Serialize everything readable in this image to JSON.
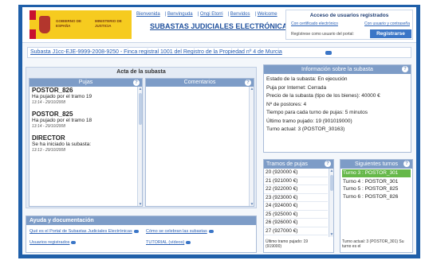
{
  "header": {
    "logo_left_text": "GOBIERNO DE ESPAÑA",
    "logo_right_text": "MINISTERIO DE JUSTICIA",
    "nav": [
      "Bienvenida",
      "Benvinguda",
      "Ongi Etorri",
      "Benvidos",
      "Welcome"
    ],
    "site_title": "SUBASTAS JUDICIALES ELECTRÓNICAS"
  },
  "registered": {
    "title": "Acceso de usuarios registrados",
    "link_certificate": "Con certificado electrónico",
    "link_password": "Con usuario y contraseña",
    "register_text": "Regístrese como usuario del portal:",
    "register_button": "Registrarse"
  },
  "breadcrumb": "Subasta J1cc-EJE-9999-2008-9250 - Finca registral 1001 del Registro de la Propiedad nº 4 de Murcia",
  "acta": {
    "title": "Acta de la subasta",
    "pujas_header": "Pujas",
    "comentarios_header": "Comentarios",
    "bids": [
      {
        "name": "POSTOR_826",
        "text": "Ha pujado por el tramo 19",
        "date": "13:14 - 29/10/2008"
      },
      {
        "name": "POSTOR_825",
        "text": "Ha pujado por el tramo 18",
        "date": "13:14 - 29/10/2008"
      },
      {
        "name": "DIRECTOR",
        "text": "Se ha iniciado la subasta:",
        "date": "13:13 - 29/10/2008"
      }
    ]
  },
  "info": {
    "title": "Información sobre la subasta",
    "lines": [
      "Estado de la subasta: En ejecución",
      "Puja por Internet: Cerrada",
      "Precio de la subasta (tipo de los bienes): 40000 €",
      "Nº de postores: 4",
      "Tiempo para cada turno de pujas: 5 minutos",
      "Último tramo pujado: 19 (901019000)",
      "Turno actual: 3 (POSTOR_30163)"
    ]
  },
  "tramos": {
    "title": "Tramos de pujas",
    "rows": [
      "20 (920000 €)",
      "21 (921000 €)",
      "22 (922000 €)",
      "23 (923000 €)",
      "24 (924000 €)",
      "25 (925000 €)",
      "26 (926000 €)",
      "27 (927000 €)"
    ],
    "footer": "Último tramo pujado: 19 (919000)"
  },
  "turnos": {
    "title": "Siguientes turnos",
    "rows": [
      "Turno 3 : POSTOR_301",
      "Turno 4 : POSTOR_301",
      "Turno 5 : POSTOR_825",
      "Turno 6 : POSTOR_826"
    ],
    "active_index": 0,
    "footer": "Turno actual: 3 (POSTOR_301) Su turno es el"
  },
  "ayuda": {
    "title": "Ayuda y documentación",
    "links": [
      "Qué es el Portal de Subastas Judiciales Electrónicas",
      "Cómo se celebran las subastas",
      "Usuarios registrados",
      "TUTORIAL (vídeos)"
    ]
  },
  "colors": {
    "frame": "#1f5fa9",
    "panel_header": "#7d9cc7",
    "link": "#2a60b5",
    "active_turn": "#66b84a"
  }
}
